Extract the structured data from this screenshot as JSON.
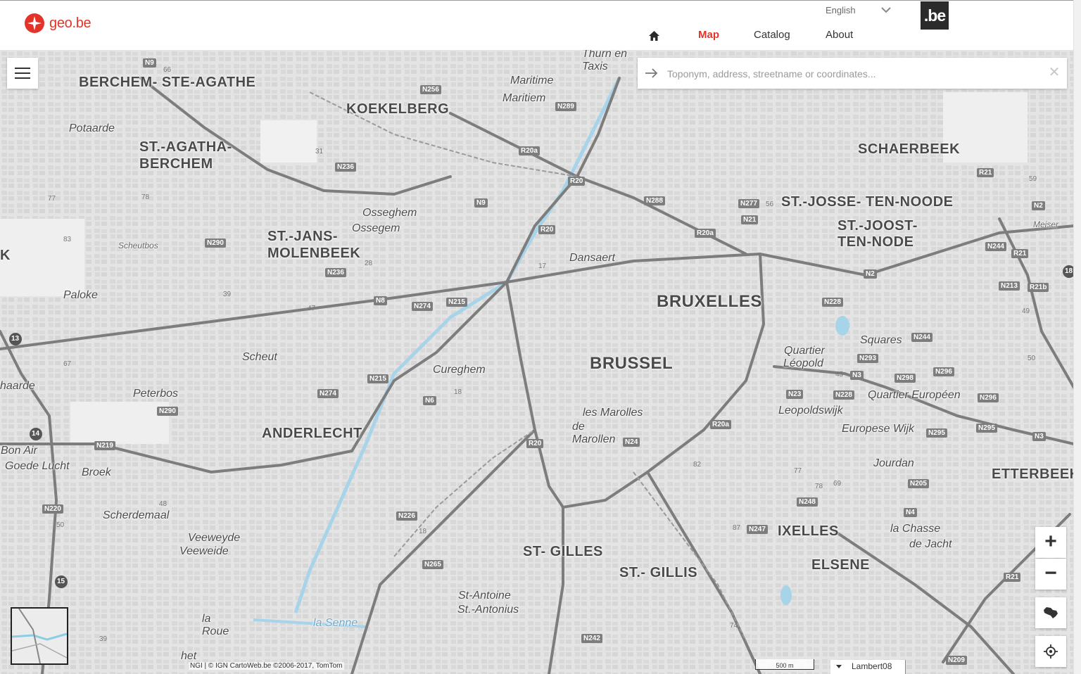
{
  "header": {
    "logo_text": "geo.be",
    "language": "English",
    "badge": ".be",
    "nav": {
      "map": "Map",
      "catalog": "Catalog",
      "about": "About"
    }
  },
  "search": {
    "placeholder": "Toponym, address, streetname or coordinates...",
    "value": ""
  },
  "colors": {
    "brand": "#e3342a",
    "water": "#a8d4ea",
    "road": "#7d7d7d"
  },
  "map": {
    "places_major": [
      "BERCHEM- STE-AGATHE",
      "KOEKELBERG",
      "ST.-AGATHA-",
      "BERCHEM",
      "ST.-JANS-",
      "MOLENBEEK",
      "SCHAERBEEK",
      "ST.-JOSSE- TEN-NOODE",
      "ST.-JOOST-",
      "TEN-NODE",
      "BRUXELLES",
      "BRUSSEL",
      "ANDERLECHT",
      "ST- GILLES",
      "ST.- GILLIS",
      "IXELLES",
      "ELSENE",
      "ETTERBEEK",
      "K",
      "haarde"
    ],
    "places_minor": [
      "Thurn en",
      "Taxis",
      "Maritime",
      "Maritiem",
      "Potaarde",
      "Osseghem",
      "Ossegem",
      "Dansaert",
      "Paloke",
      "Scheut",
      "Cureghem",
      "Peterbos",
      "Bon Air",
      "Goede Lucht",
      "Broek",
      "Scherdemaal",
      "Veeweyde",
      "Veeweide",
      "la",
      "Roue",
      "het",
      "Quartier",
      "Léopold",
      "Squares",
      "Quartier Européen",
      "Leopoldswijk",
      "Europese Wijk",
      "Jourdan",
      "la Chasse",
      "de Jacht",
      "les Marolles",
      "de",
      "Marollen",
      "St-Antoine",
      "St.-Antonius",
      "la Senne"
    ],
    "places_tiny": [
      "Scheutbos",
      "Meiser"
    ],
    "roads": [
      "N9",
      "N256",
      "N289",
      "R20a",
      "N236",
      "R20",
      "N288",
      "N9",
      "N277",
      "N21",
      "N290",
      "R20",
      "R20a",
      "N236",
      "N8",
      "N274",
      "N215",
      "N228",
      "R21",
      "N2",
      "N244",
      "R21",
      "N213",
      "R21b",
      "N2",
      "N244",
      "N293",
      "N3",
      "N298",
      "N296",
      "N215",
      "N274",
      "N6",
      "N23",
      "N228",
      "N296",
      "N290",
      "R20",
      "N24",
      "R20a",
      "N295",
      "N295",
      "N3",
      "N219",
      "N220",
      "N226",
      "N205",
      "N248",
      "N4",
      "N265",
      "N247",
      "N242",
      "R21",
      "N209"
    ],
    "numbers": [
      "66",
      "77",
      "78",
      "83",
      "39",
      "47",
      "31",
      "28",
      "17",
      "56",
      "59",
      "49",
      "50",
      "67",
      "48",
      "50",
      "39",
      "18",
      "18",
      "82",
      "77",
      "78",
      "69",
      "87",
      "74",
      "45"
    ],
    "ring_roads": [
      "13",
      "14",
      "15",
      "18"
    ]
  },
  "controls": {
    "zoom_in": "+",
    "zoom_out": "−"
  },
  "footer": {
    "attribution": "NGI | © IGN CartoWeb.be ©2006-2017, TomTom",
    "scale": "500 m",
    "projection": "Lambert08"
  }
}
